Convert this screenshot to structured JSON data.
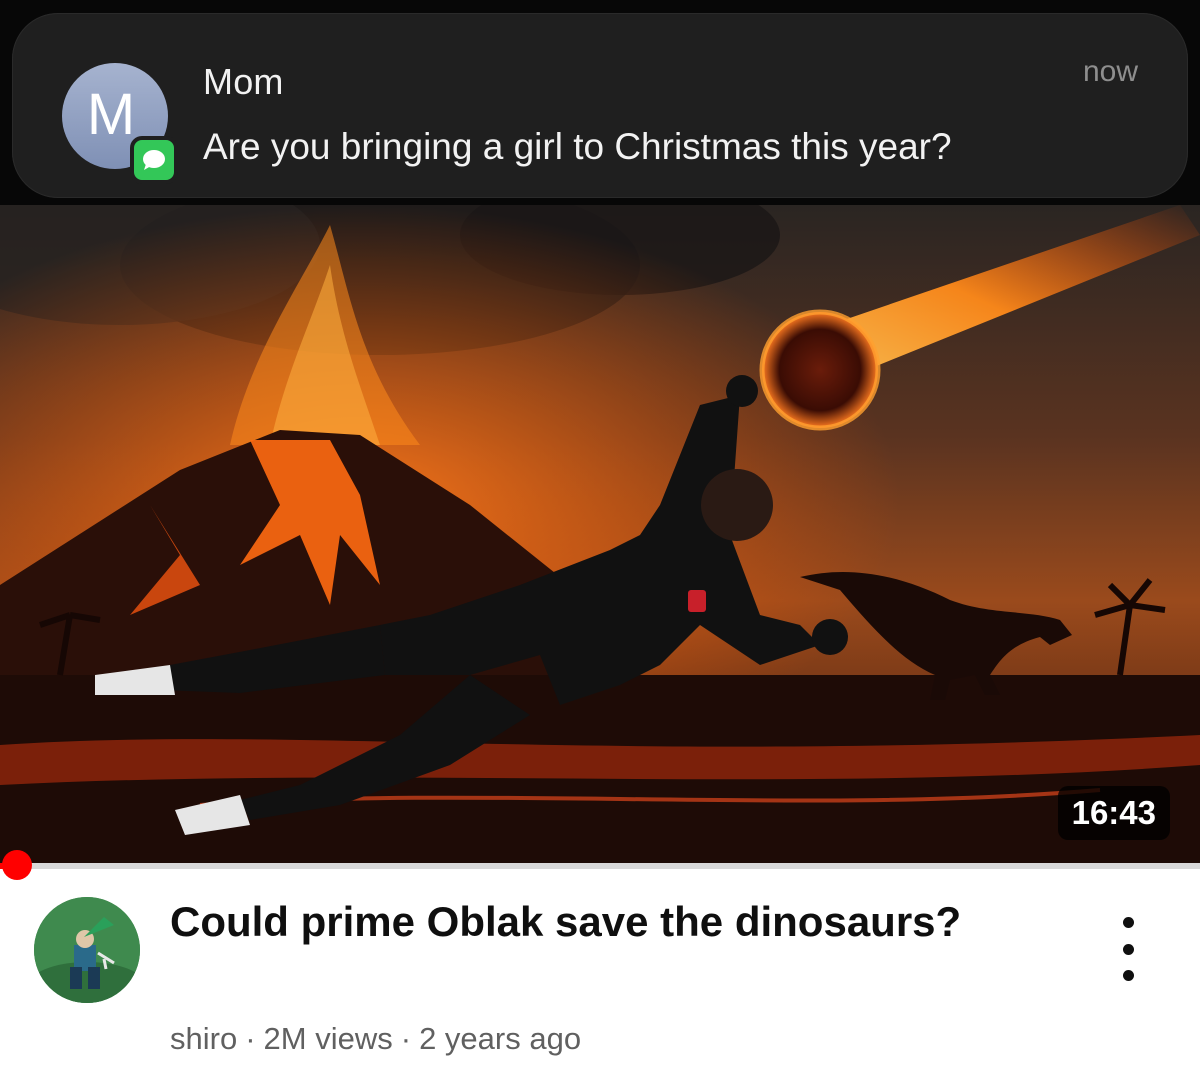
{
  "notification": {
    "avatar_letter": "M",
    "app_icon": "messages-bubble-icon",
    "sender": "Mom",
    "message": "Are you bringing a girl to Christmas this year?",
    "time": "now",
    "avatar_color": "#8f9fc3",
    "badge_color": "#33c758"
  },
  "video": {
    "duration": "16:43",
    "watched_progress": 0.01,
    "title": "Could prime Oblak save the dinosaurs?",
    "channel": "shiro",
    "views": "2M views",
    "age": "2 years ago",
    "separator": "·",
    "more_icon": "vertical-ellipsis-icon",
    "progress_color": "#ff0000"
  }
}
